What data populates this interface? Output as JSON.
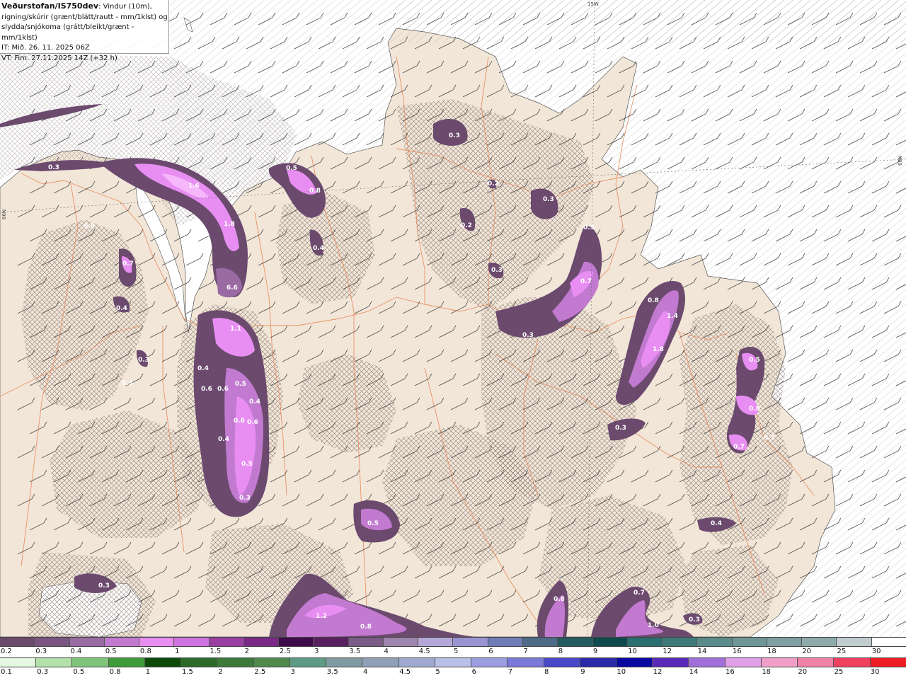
{
  "header": {
    "source_bold": "Veðurstofan/IS750dev",
    "line1_rest": ": Vindur (10m),",
    "line2": "rigning/skúrir (grænt/blátt/rautt - mm/1klst) og",
    "line3": "slydda/snjókoma (grátt/bleikt/grænt - mm/1klst)",
    "line4": "IT: Mið. 26. 11. 2025 06Z",
    "line5": "VT: Fim. 27.11.2025 14Z (+32 h)"
  },
  "map": {
    "grid_labels": {
      "top": "15W",
      "right": "66N",
      "left": "66N"
    },
    "colors": {
      "sea": "#ffffff",
      "land": "#f2e6d8",
      "roads": "#e8895a",
      "hatch": "#6b5a55"
    },
    "precip_labels": [
      "0.3",
      "1.6",
      "1.8",
      "0.4",
      "0.4",
      "6.6",
      "0.7",
      "0.4",
      "0.3",
      "1.1",
      "0.4",
      "0.6",
      "0.6",
      "0.5",
      "0.4",
      "0.6",
      "0.6",
      "0.4",
      "0.5",
      "0.3",
      "0.5",
      "0.8",
      "0.4",
      "0.3",
      "0.2",
      "0.2",
      "0.3",
      "0.3",
      "0.3",
      "0.7",
      "0.3",
      "0.8",
      "1.4",
      "1.8",
      "0.3",
      "0.5",
      "0.8",
      "0.7",
      "0.3",
      "0.4",
      "0.5",
      "0.3",
      "1.2",
      "0.8",
      "0.8",
      "0.7",
      "1.0",
      "0.3",
      "0.3"
    ]
  },
  "legend_rain": {
    "labels": [
      "0.2",
      "0.3",
      "0.4",
      "0.5",
      "0.8",
      "1",
      "1.5",
      "2",
      "2.5",
      "3",
      "3.5",
      "4",
      "4.5",
      "5",
      "6",
      "7",
      "8",
      "9",
      "10",
      "12",
      "14",
      "16",
      "18",
      "20",
      "25",
      "30"
    ],
    "colors": [
      "#6b4a6e",
      "#7a5580",
      "#9a6aa3",
      "#c27ad0",
      "#e88ef2",
      "#d073e0",
      "#9b3fa5",
      "#7a2a86",
      "#3f0b4a",
      "#58205f",
      "#7a5c86",
      "#9f86ad",
      "#b5a8d8",
      "#9b94d2",
      "#6f7cb8",
      "#4d6a86",
      "#245a60",
      "#0f4a4e",
      "#2a6e70",
      "#3f7a7a",
      "#5a8a8a",
      "#6f9696",
      "#7f9fa0",
      "#8faaaa",
      "#c0cccd",
      "#ffffff"
    ]
  },
  "legend_snow": {
    "labels": [
      "0.1",
      "0.3",
      "0.5",
      "0.8",
      "1",
      "1.5",
      "2",
      "2.5",
      "3",
      "3.5",
      "4",
      "4.5",
      "5",
      "6",
      "7",
      "8",
      "9",
      "10",
      "12",
      "14",
      "16",
      "18",
      "20",
      "25",
      "30"
    ],
    "colors": [
      "#e3f7e1",
      "#b2e1aa",
      "#7fc47a",
      "#3f9a3a",
      "#0d4a0a",
      "#2d6a2a",
      "#3d7a3a",
      "#4f8a4c",
      "#5f9a84",
      "#7f9aa0",
      "#8fa0b8",
      "#a0aad0",
      "#b8c0e8",
      "#9c9ce0",
      "#7a78d8",
      "#4a48c8",
      "#2a2aa8",
      "#0a0aa0",
      "#5a2ab8",
      "#a070d8",
      "#e0a0e8",
      "#f0a0c8",
      "#f080a8",
      "#f04060",
      "#ee1c24"
    ]
  }
}
